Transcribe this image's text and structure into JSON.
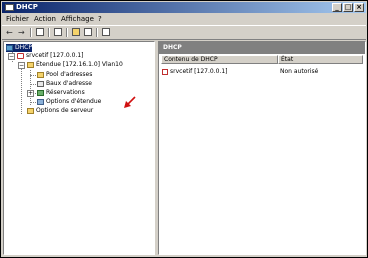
{
  "window": {
    "title": "DHCP"
  },
  "menu": [
    "Fichier",
    "Action",
    "Affichage",
    "?"
  ],
  "tree": {
    "root": "DHCP",
    "server": "srvcetif [127.0.0.1]",
    "scope": "Étendue [172.16.1.0] Vlan10",
    "children": [
      "Pool d'adresses",
      "Baux d'adresse",
      "Réservations",
      "Options d'étendue"
    ],
    "server_options": "Options de serveur"
  },
  "right_pane": {
    "header": "DHCP",
    "columns": [
      "Contenu de DHCP",
      "État"
    ],
    "rows": [
      {
        "name": "srvcetif [127.0.0.1]",
        "state": "Non autorisé"
      }
    ]
  },
  "colors": {
    "title_start": "#0a246a",
    "title_end": "#a6caf0",
    "annotation_arrow": "#d01010"
  }
}
